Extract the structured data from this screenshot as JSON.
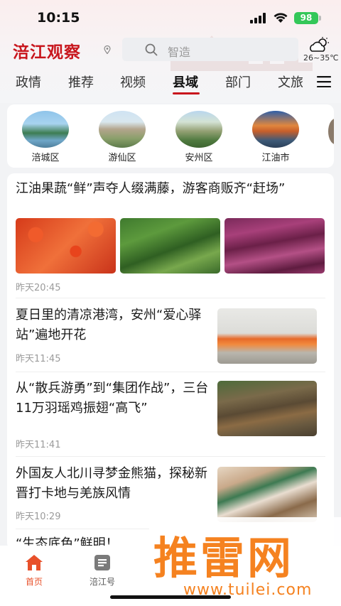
{
  "status": {
    "time": "10:15",
    "battery": "98"
  },
  "header": {
    "logo": "涪江观察",
    "search_placeholder": "智造",
    "weather_temp": "26~35℃"
  },
  "tabs": [
    {
      "label": "政情"
    },
    {
      "label": "推荐"
    },
    {
      "label": "视频"
    },
    {
      "label": "县域",
      "active": true
    },
    {
      "label": "部门"
    },
    {
      "label": "文旅"
    }
  ],
  "regions": [
    {
      "label": "涪城区"
    },
    {
      "label": "游仙区"
    },
    {
      "label": "安州区"
    },
    {
      "label": "江油市"
    }
  ],
  "news": [
    {
      "title": "江油果蔬“鲜”声夺人缀满藤，游客商贩齐“赶场”",
      "time": "昨天20:45"
    },
    {
      "title": "夏日里的清凉港湾，安州“爱心驿站”遍地开花",
      "time": "昨天11:45"
    },
    {
      "title": "从“散兵游勇”到“集团作战”，三台11万羽瑶鸡振翅“高飞”",
      "time": "昨天11:41"
    },
    {
      "title": "外国友人北川寻梦金熊猫，探秘新晋打卡地与羌族风情",
      "time": "昨天10:29"
    },
    {
      "title": "“生态底色”鲜明！"
    }
  ],
  "bottom_nav": [
    {
      "label": "首页",
      "active": true
    },
    {
      "label": "涪江号"
    }
  ],
  "watermark": {
    "text": "推雷网",
    "url": "www.tuilei.com"
  },
  "colors": {
    "brand": "#c8161d",
    "watermark": "#f58220",
    "battery": "#34c759"
  }
}
